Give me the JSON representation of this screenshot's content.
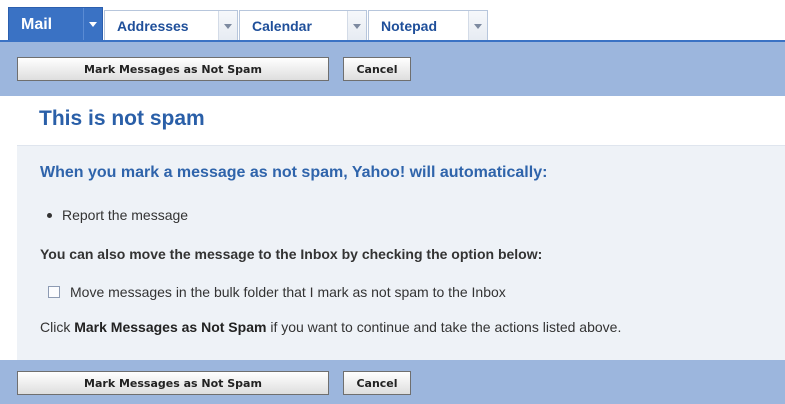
{
  "tabs": [
    {
      "label": "Mail",
      "active": true
    },
    {
      "label": "Addresses",
      "active": false
    },
    {
      "label": "Calendar",
      "active": false
    },
    {
      "label": "Notepad",
      "active": false
    }
  ],
  "toolbar": {
    "mark_label": "Mark Messages as Not Spam",
    "cancel_label": "Cancel"
  },
  "main": {
    "title": "This is not spam",
    "subheading": "When you mark a message as not spam, Yahoo! will automatically:",
    "bullets": [
      "Report the message"
    ],
    "move_heading": "You can also move the message to the Inbox by checking the option below:",
    "checkbox_label": "Move messages in the bulk folder that I mark as not spam to the Inbox",
    "checkbox_checked": false,
    "instruction_prefix": "Click ",
    "instruction_bold": "Mark Messages as Not Spam",
    "instruction_suffix": " if you want to continue and take the actions listed above."
  },
  "colors": {
    "accent": "#3a72c4",
    "toolbar": "#9cb6dd",
    "title": "#2a5fa8"
  },
  "icons": {
    "tab_menu": "chevron-down-icon",
    "checkbox": "checkbox-icon",
    "bullet": "bullet-icon"
  }
}
